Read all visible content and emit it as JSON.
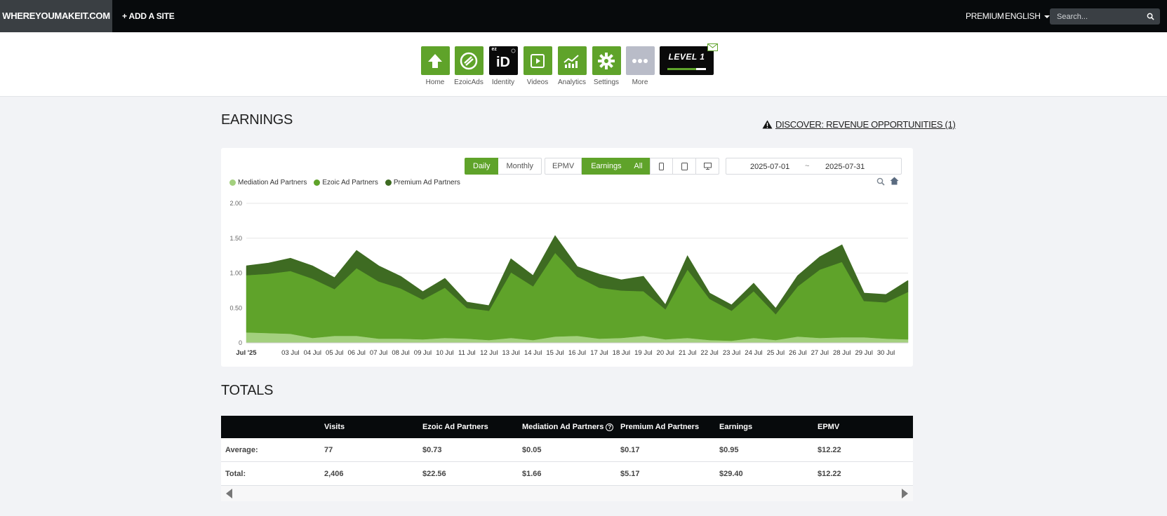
{
  "topbar": {
    "site_name": "WHEREYOUMAKEIT.COM",
    "add_site": "+ ADD A SITE",
    "premium": "PREMIUM",
    "language": "ENGLISH",
    "search_placeholder": "Search..."
  },
  "apps": [
    {
      "label": "Home",
      "icon": "house-arrow-icon"
    },
    {
      "label": "EzoicAds",
      "icon": "ezoic-logo-icon"
    },
    {
      "label": "Identity",
      "icon": "identity-id-icon",
      "tile_top_text": "ez",
      "tile_text": "iD"
    },
    {
      "label": "Videos",
      "icon": "video-play-icon"
    },
    {
      "label": "Analytics",
      "icon": "analytics-chart-icon"
    },
    {
      "label": "Settings",
      "icon": "gear-icon"
    },
    {
      "label": "More",
      "icon": "ellipsis-icon"
    }
  ],
  "level": {
    "label": "LEVEL 1",
    "progress": 0.75
  },
  "earnings": {
    "title": "EARNINGS",
    "discover_link": "DISCOVER: REVENUE OPPORTUNITIES (1)"
  },
  "controls": {
    "daily": "Daily",
    "monthly": "Monthly",
    "epmv": "EPMV",
    "earnings": "Earnings",
    "all": "All",
    "date_from": "2025-07-01",
    "date_sep": "~",
    "date_to": "2025-07-31"
  },
  "chart_data": {
    "type": "area",
    "stacked": true,
    "ylim": [
      0,
      2.0
    ],
    "yticks": [
      "0",
      "0.50",
      "1.00",
      "1.50",
      "2.00"
    ],
    "ytick_values": [
      0,
      0.5,
      1.0,
      1.5,
      2.0
    ],
    "xtick_labels": [
      "Jul '25",
      "03 Jul",
      "04 Jul",
      "05 Jul",
      "06 Jul",
      "07 Jul",
      "08 Jul",
      "09 Jul",
      "10 Jul",
      "11 Jul",
      "12 Jul",
      "13 Jul",
      "14 Jul",
      "15 Jul",
      "16 Jul",
      "17 Jul",
      "18 Jul",
      "19 Jul",
      "20 Jul",
      "21 Jul",
      "22 Jul",
      "23 Jul",
      "24 Jul",
      "25 Jul",
      "26 Jul",
      "27 Jul",
      "28 Jul",
      "29 Jul",
      "30 Jul"
    ],
    "xtick_days": [
      1,
      3,
      4,
      5,
      6,
      7,
      8,
      9,
      10,
      11,
      12,
      13,
      14,
      15,
      16,
      17,
      18,
      19,
      20,
      21,
      22,
      23,
      24,
      25,
      26,
      27,
      28,
      29,
      30
    ],
    "x": [
      1,
      2,
      3,
      4,
      5,
      6,
      7,
      8,
      9,
      10,
      11,
      12,
      13,
      14,
      15,
      16,
      17,
      18,
      19,
      20,
      21,
      22,
      23,
      24,
      25,
      26,
      27,
      28,
      29,
      30,
      31
    ],
    "series": [
      {
        "name": "Mediation Ad Partners",
        "color": "#a3d07e",
        "values": [
          0.15,
          0.14,
          0.13,
          0.07,
          0.1,
          0.1,
          0.06,
          0.06,
          0.05,
          0.07,
          0.06,
          0.04,
          0.07,
          0.04,
          0.09,
          0.1,
          0.06,
          0.07,
          0.1,
          0.05,
          0.07,
          0.04,
          0.03,
          0.07,
          0.04,
          0.09,
          0.07,
          0.08,
          0.08,
          0.06,
          0.05
        ]
      },
      {
        "name": "Ezoic Ad Partners",
        "color": "#5fa32a",
        "values": [
          0.82,
          0.85,
          0.9,
          0.85,
          0.67,
          0.97,
          0.82,
          0.72,
          0.57,
          0.72,
          0.44,
          0.42,
          0.94,
          0.77,
          1.2,
          0.85,
          0.73,
          0.68,
          0.64,
          0.43,
          0.98,
          0.59,
          0.43,
          0.67,
          0.37,
          0.72,
          0.98,
          1.08,
          0.52,
          0.52,
          0.68
        ]
      },
      {
        "name": "Premium Ad Partners",
        "color": "#3e6b22",
        "values": [
          0.13,
          0.15,
          0.18,
          0.18,
          0.16,
          0.25,
          0.22,
          0.17,
          0.11,
          0.13,
          0.08,
          0.07,
          0.19,
          0.15,
          0.24,
          0.14,
          0.19,
          0.15,
          0.21,
          0.06,
          0.19,
          0.08,
          0.08,
          0.11,
          0.08,
          0.15,
          0.18,
          0.24,
          0.11,
          0.11,
          0.16
        ]
      }
    ]
  },
  "totals": {
    "title": "TOTALS",
    "headers": [
      "",
      "Visits",
      "Ezoic Ad Partners",
      "Mediation Ad Partners",
      "Premium Ad Partners",
      "Earnings",
      "EPMV"
    ],
    "rows": [
      {
        "label": "Average:",
        "values": [
          "77",
          "$0.73",
          "$0.05",
          "$0.17",
          "$0.95",
          "$12.22"
        ]
      },
      {
        "label": "Total:",
        "values": [
          "2,406",
          "$22.56",
          "$1.66",
          "$5.17",
          "$29.40",
          "$12.22"
        ]
      }
    ]
  }
}
